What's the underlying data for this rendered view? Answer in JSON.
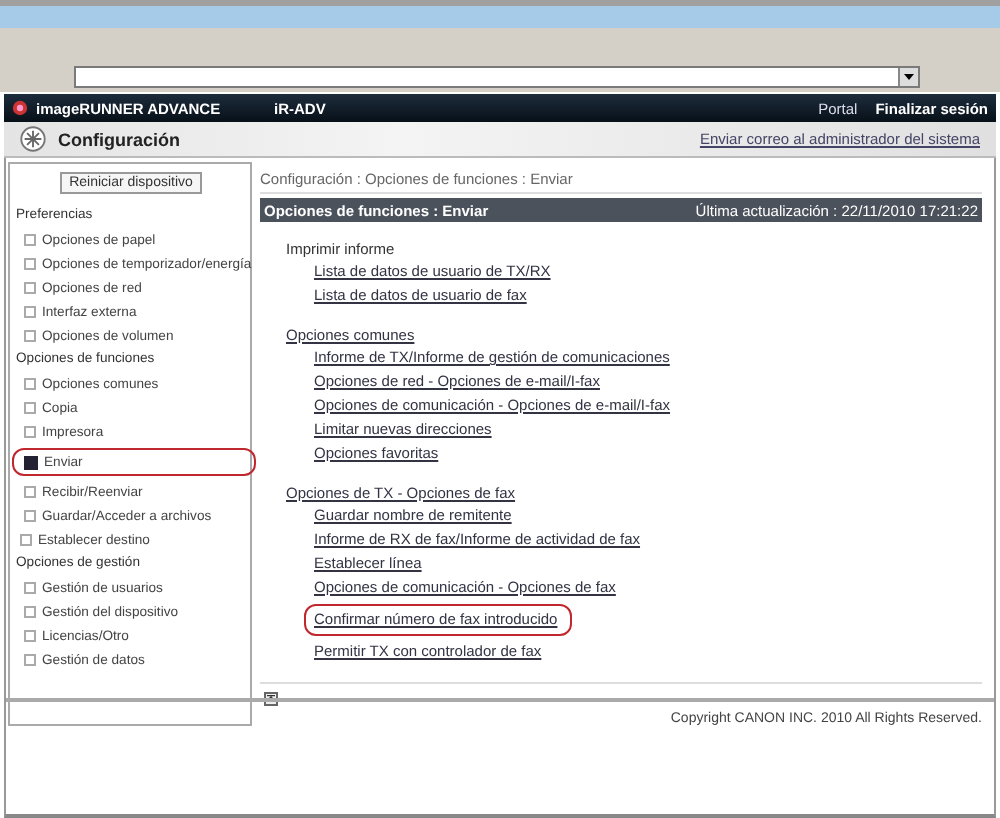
{
  "header": {
    "product": "imageRUNNER ADVANCE",
    "model": "iR-ADV",
    "links": [
      "Portal",
      "Finalizar sesión"
    ]
  },
  "config_bar": {
    "title": "Configuración",
    "mail_link": "Enviar correo al administrador del sistema"
  },
  "sidebar": {
    "reset_button": "Reiniciar dispositivo",
    "entries": [
      {
        "kind": "section",
        "label": "Preferencias",
        "items": [
          {
            "label": "Opciones de papel",
            "selected": false,
            "highlighted": false
          },
          {
            "label": "Opciones de temporizador/energía",
            "selected": false,
            "highlighted": false
          },
          {
            "label": "Opciones de red",
            "selected": false,
            "highlighted": false
          },
          {
            "label": "Interfaz externa",
            "selected": false,
            "highlighted": false
          },
          {
            "label": "Opciones de volumen",
            "selected": false,
            "highlighted": false
          }
        ]
      },
      {
        "kind": "section",
        "label": "Opciones de funciones",
        "items": [
          {
            "label": "Opciones comunes",
            "selected": false,
            "highlighted": false
          },
          {
            "label": "Copia",
            "selected": false,
            "highlighted": false
          },
          {
            "label": "Impresora",
            "selected": false,
            "highlighted": false
          },
          {
            "label": "Enviar",
            "selected": true,
            "highlighted": true
          },
          {
            "label": "Recibir/Reenviar",
            "selected": false,
            "highlighted": false
          },
          {
            "label": "Guardar/Acceder a archivos",
            "selected": false,
            "highlighted": false
          }
        ]
      },
      {
        "kind": "item",
        "label": "Establecer destino",
        "selected": false,
        "highlighted": false
      },
      {
        "kind": "section",
        "label": "Opciones de gestión",
        "items": [
          {
            "label": "Gestión de usuarios",
            "selected": false,
            "highlighted": false
          },
          {
            "label": "Gestión del dispositivo",
            "selected": false,
            "highlighted": false
          },
          {
            "label": "Licencias/Otro",
            "selected": false,
            "highlighted": false
          },
          {
            "label": "Gestión de datos",
            "selected": false,
            "highlighted": false
          }
        ]
      }
    ]
  },
  "main": {
    "breadcrumb": "Configuración : Opciones de funciones : Enviar",
    "panel_title": "Opciones de funciones : Enviar",
    "last_updated": "Última actualización : 22/11/2010 17:21:22",
    "groups": [
      {
        "title": "Imprimir informe",
        "kind": "heading",
        "links": [
          {
            "label": "Lista de datos de usuario de TX/RX",
            "highlighted": false
          },
          {
            "label": "Lista de datos de usuario de fax",
            "highlighted": false
          }
        ]
      },
      {
        "title": "Opciones comunes",
        "kind": "link",
        "links": [
          {
            "label": "Informe de TX/Informe de gestión de comunicaciones",
            "highlighted": false
          },
          {
            "label": "Opciones de red - Opciones de e-mail/I-fax",
            "highlighted": false
          },
          {
            "label": "Opciones de comunicación - Opciones de e-mail/I-fax",
            "highlighted": false
          },
          {
            "label": "Limitar nuevas direcciones",
            "highlighted": false
          },
          {
            "label": "Opciones favoritas",
            "highlighted": false
          }
        ]
      },
      {
        "title": "Opciones de TX - Opciones de fax",
        "kind": "link",
        "links": [
          {
            "label": "Guardar nombre de remitente",
            "highlighted": false
          },
          {
            "label": "Informe de RX de fax/Informe de actividad de fax",
            "highlighted": false
          },
          {
            "label": "Establecer línea",
            "highlighted": false
          },
          {
            "label": "Opciones de comunicación - Opciones de fax",
            "highlighted": false
          },
          {
            "label": "Confirmar número de fax introducido",
            "highlighted": true
          },
          {
            "label": "Permitir TX con controlador de fax",
            "highlighted": false
          }
        ]
      }
    ]
  },
  "footer": {
    "copyright": "Copyright CANON INC. 2010 All Rights Reserved."
  }
}
